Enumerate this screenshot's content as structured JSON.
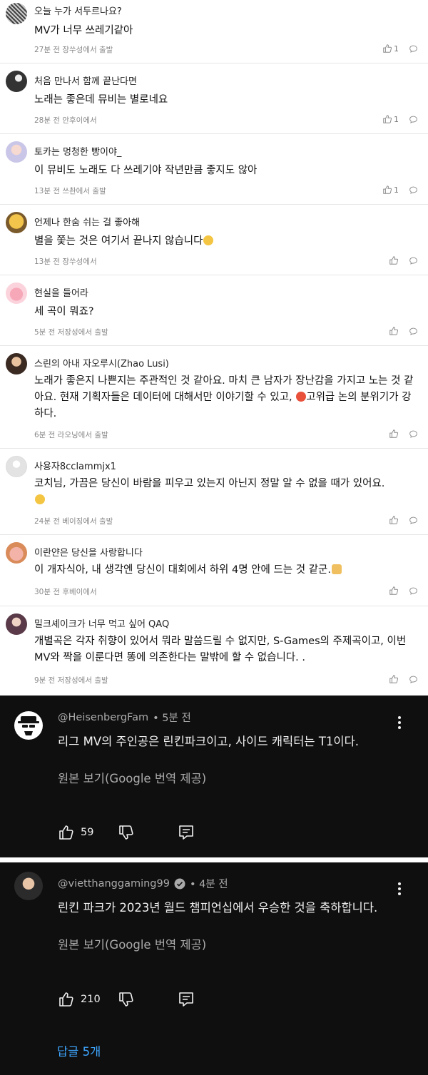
{
  "light_comments": [
    {
      "name": "오늘 누가 서두르나요?",
      "text": "MV가 너무 쓰레기같아",
      "meta": "27분 전 장쑤성에서 출발",
      "likes": "1"
    },
    {
      "name": "처음 만나서 함께 끝난다면",
      "text": "노래는 좋은데 뮤비는 별로네요",
      "meta": "28분 전 안후이에서",
      "likes": "1"
    },
    {
      "name": "토카는 멍청한 빵이야_",
      "text": "이 뮤비도 노래도 다 쓰레기야 작년만큼 좋지도 않아",
      "meta": "13분 전 쓰촨에서 출발",
      "likes": "1"
    },
    {
      "name": "언제나 한숨 쉬는 걸 좋아해",
      "text": "별을 쫓는 것은 여기서 끝나지 않습니다",
      "meta": "13분 전 장쑤성에서",
      "likes": ""
    },
    {
      "name": "현실을 들어라",
      "text": "세 곡이 뭐죠?",
      "meta": "5분 전 저장성에서 출발",
      "likes": ""
    },
    {
      "name": "스린의 아내 자오루시(Zhao Lusi)",
      "text_a": "노래가 좋은지 나쁜지는 주관적인 것 같아요. 마치 큰 남자가 장난감을 가지고 노는 것 같아요. 현재 기획자들은 데이터에 대해서만 이야기할 수 있고,",
      "text_b": "고위급 논의 분위기가 강하다.",
      "meta": "6분 전 라오닝에서 출발",
      "likes": ""
    },
    {
      "name": "사용자8cclammjx1",
      "text": "코치님, 가끔은 당신이 바람을 피우고 있는지 아닌지 정말 알 수 없을 때가 있어요.",
      "meta": "24분 전 베이징에서 출발",
      "likes": ""
    },
    {
      "name": "이란얀은 당신을 사랑합니다",
      "text": "이 개자식아, 내 생각엔 당신이 대회에서 하위 4명 안에 드는 것 같군.",
      "meta": "30분 전 후베이에서",
      "likes": ""
    },
    {
      "name": "밀크셰이크가 너무 먹고 싶어 QAQ",
      "text": "개별곡은 각자 취향이 있어서 뭐라 말씀드릴 수 없지만, S-Games의 주제곡이고, 이번 MV와 짝을 이룬다면 똥에 의존한다는 말밖에 할 수 없습니다. .",
      "meta": "9분 전 저장성에서 출발",
      "likes": ""
    }
  ],
  "yt_comments": [
    {
      "handle": "@HeisenbergFam",
      "time": "• 5분 전",
      "text": "리그 MV의 주인공은 린킨파크이고, 사이드 캐릭터는 T1이다.",
      "translate": "원본 보기(Google 번역 제공)",
      "likes": "59"
    },
    {
      "handle": "@vietthanggaming99",
      "time": "• 4분 전",
      "text": "린킨 파크가 2023년 월드 챔피언십에서 우승한 것을 축하합니다.",
      "translate": "원본 보기(Google 번역 제공)",
      "likes": "210",
      "replies": "답글 5개"
    }
  ],
  "colors": {
    "dark_bg": "#0f0f0f",
    "reply_link": "#3ea6ff"
  }
}
